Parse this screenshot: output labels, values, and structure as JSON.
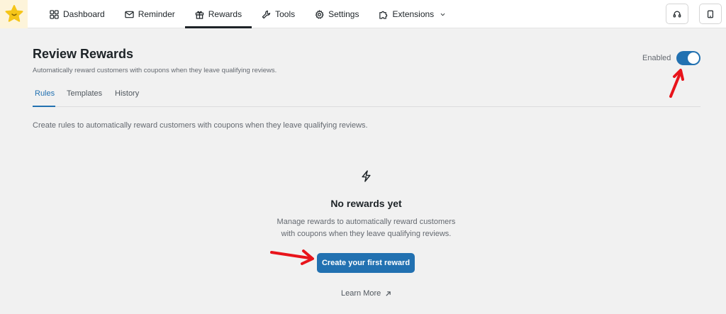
{
  "nav": {
    "items": [
      {
        "label": "Dashboard",
        "icon": "grid-icon"
      },
      {
        "label": "Reminder",
        "icon": "mail-icon"
      },
      {
        "label": "Rewards",
        "icon": "gift-icon",
        "active": true
      },
      {
        "label": "Tools",
        "icon": "wrench-icon"
      },
      {
        "label": "Settings",
        "icon": "gear-icon"
      },
      {
        "label": "Extensions",
        "icon": "puzzle-icon",
        "has_dropdown": true
      }
    ]
  },
  "header_buttons": [
    "headset-icon",
    "tablet-icon"
  ],
  "page": {
    "title": "Review Rewards",
    "subtitle": "Automatically reward customers with coupons when they leave qualifying reviews.",
    "enabled_label": "Enabled",
    "enabled": true
  },
  "tabs": [
    {
      "label": "Rules",
      "active": true
    },
    {
      "label": "Templates"
    },
    {
      "label": "History"
    }
  ],
  "rules": {
    "description": "Create rules to automatically reward customers with coupons when they leave qualifying reviews."
  },
  "empty_state": {
    "icon": "lightning-icon",
    "title": "No rewards yet",
    "text_line1": "Manage rewards to automatically reward customers",
    "text_line2": "with coupons when they leave qualifying reviews.",
    "button_label": "Create your first reward",
    "link_label": "Learn More"
  },
  "colors": {
    "accent": "#2271b1",
    "annotation_arrow": "#e8141b",
    "logo": "#f5c518"
  }
}
